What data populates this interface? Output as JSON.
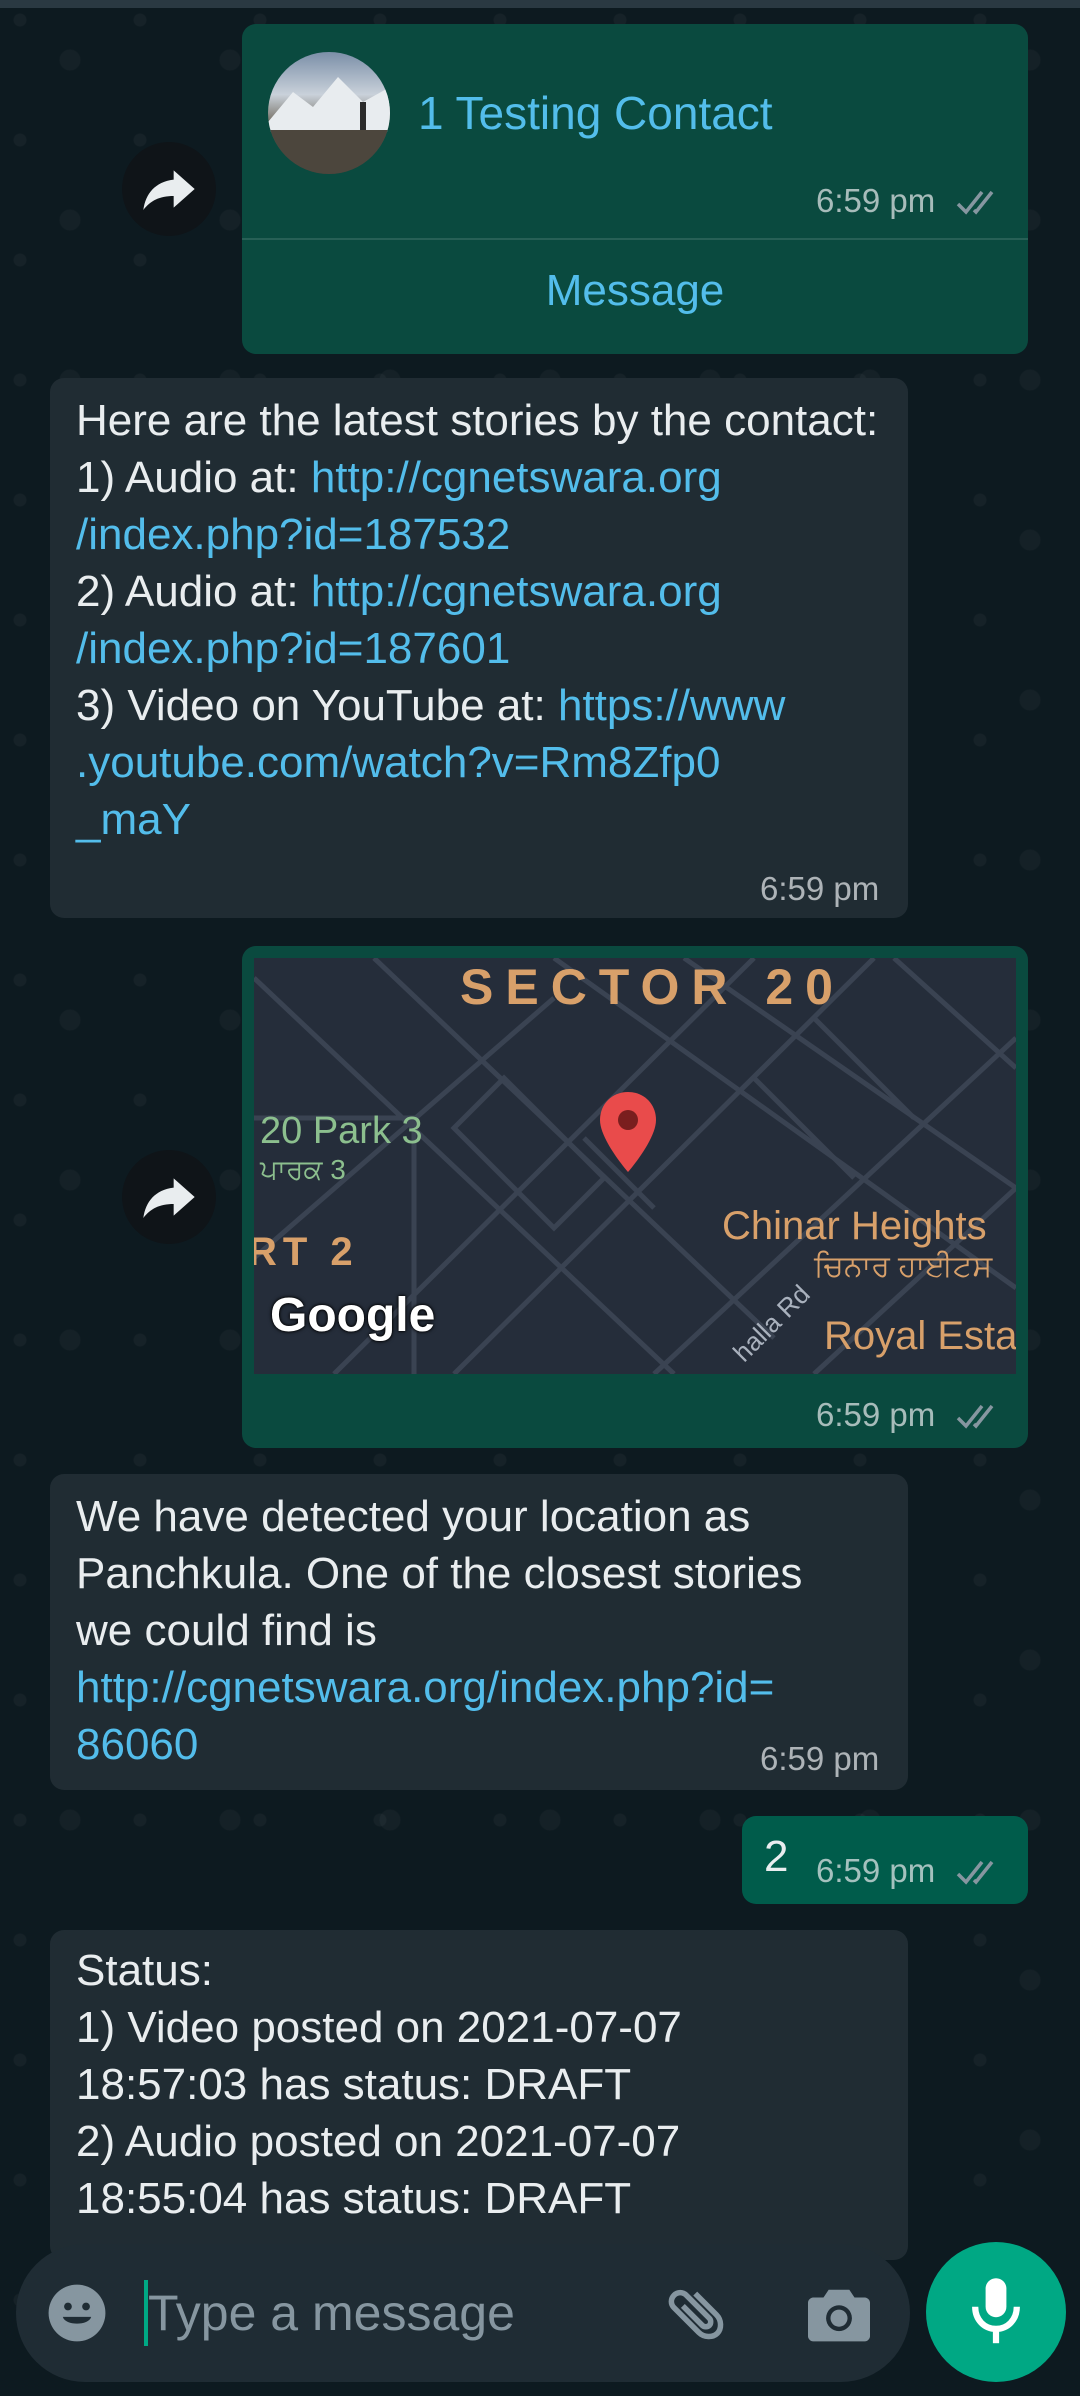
{
  "contact_card": {
    "name": "1 Testing Contact",
    "time": "6:59 pm",
    "action": "Message"
  },
  "stories_message": {
    "intro": "Here are the latest stories by the contact:",
    "item1_prefix": "1) Audio at: ",
    "item1_link_a": "http://cgnetswara.org",
    "item1_link_b": "/index.php?id=187532",
    "item2_prefix": "2) Audio at: ",
    "item2_link_a": "http://cgnetswara.org",
    "item2_link_b": "/index.php?id=187601",
    "item3_prefix": "3) Video on YouTube at: ",
    "item3_link_a": "https://www",
    "item3_link_b": ".youtube.com/watch?v=Rm8Zfp0",
    "item3_link_c": "_maY",
    "time": "6:59 pm"
  },
  "location_message": {
    "map_labels": {
      "sector": "SECTOR 20",
      "park": "20 Park 3",
      "park_local": "ਪਾਰਕ 3",
      "rt": "RT 2",
      "chinar": "Chinar Heights",
      "chinar_local": "ਚਿਨਾਰ ਹਾਈਟਸ",
      "road": "halla Rd",
      "royal": "Royal Esta",
      "google": "Google"
    },
    "time": "6:59 pm"
  },
  "detected_message": {
    "line1": "We have detected your location as",
    "line2": "Panchkula. One of the closest stories",
    "line3": "we could find is",
    "link_a": "http://cgnetswara.org/index.php?id=",
    "link_b": "86060",
    "time": "6:59 pm"
  },
  "reply_message": {
    "text": "2",
    "time": "6:59 pm"
  },
  "status_message": {
    "line1": "Status:",
    "line2": "1) Video posted on 2021-07-07",
    "line3": "18:57:03 has status: DRAFT",
    "line4": "2) Audio posted on 2021-07-07",
    "line5": "18:55:04 has status: DRAFT"
  },
  "composer": {
    "placeholder": "Type a message"
  },
  "colors": {
    "outgoing": "#005c4b",
    "incoming": "#202c33",
    "link": "#53bdeb",
    "accent": "#00a884"
  }
}
